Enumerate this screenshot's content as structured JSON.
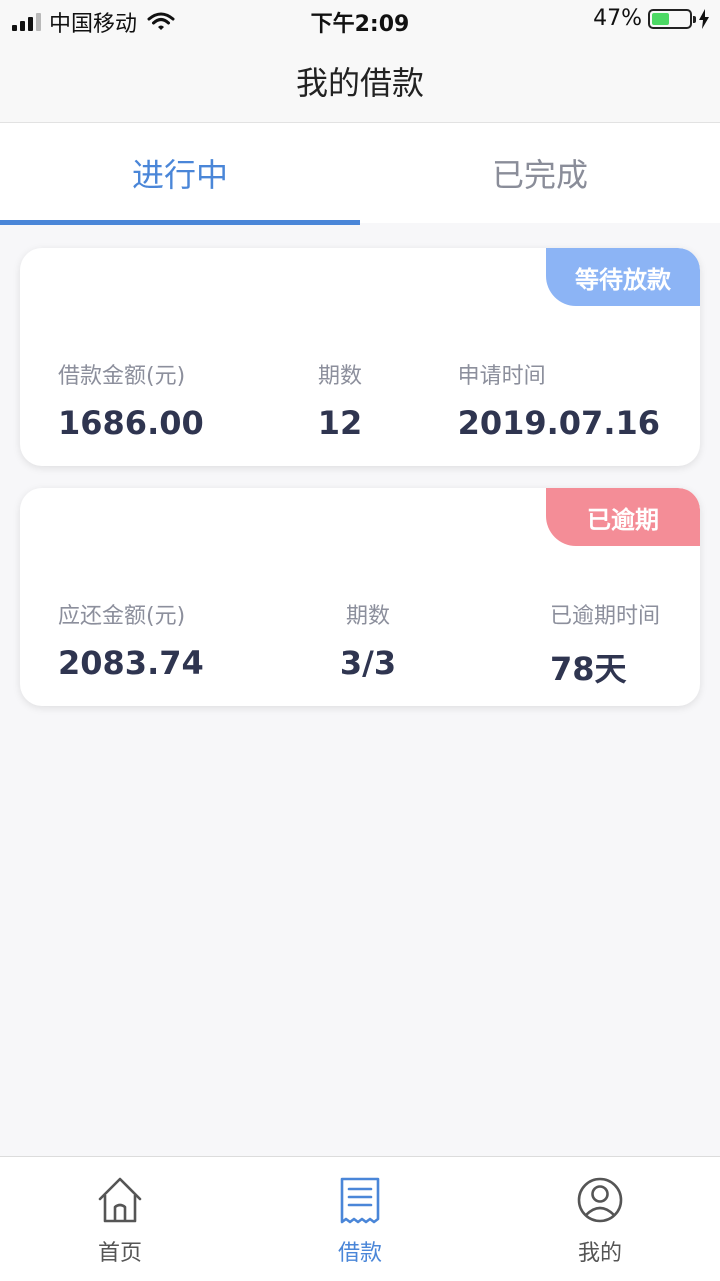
{
  "status_bar": {
    "carrier": "中国移动",
    "time": "下午2:09",
    "battery_percent": "47%",
    "battery_level": 0.47,
    "icons": [
      "signal-icon",
      "wifi-icon",
      "battery-icon",
      "charging-bolt-icon"
    ]
  },
  "nav": {
    "title": "我的借款"
  },
  "tabs": [
    {
      "label": "进行中",
      "active": true
    },
    {
      "label": "已完成",
      "active": false
    }
  ],
  "loans": [
    {
      "badge": "等待放款",
      "badge_color": "#8cb4f5",
      "fields": [
        {
          "label": "借款金额(元)",
          "value": "1686.00"
        },
        {
          "label": "期数",
          "value": "12"
        },
        {
          "label": "申请时间",
          "value": "2019.07.16"
        }
      ]
    },
    {
      "badge": "已逾期",
      "badge_color": "#f48d97",
      "fields": [
        {
          "label": "应还金额(元)",
          "value": "2083.74"
        },
        {
          "label": "期数",
          "value": "3/3"
        },
        {
          "label": "已逾期时间",
          "value": "78天"
        }
      ]
    }
  ],
  "tabbar": [
    {
      "label": "首页",
      "icon": "home-icon",
      "active": false
    },
    {
      "label": "借款",
      "icon": "receipt-icon",
      "active": true
    },
    {
      "label": "我的",
      "icon": "user-icon",
      "active": false
    }
  ],
  "colors": {
    "accent": "#4a86d8",
    "text_dark": "#2f3550",
    "text_muted": "#8c8f9c"
  }
}
